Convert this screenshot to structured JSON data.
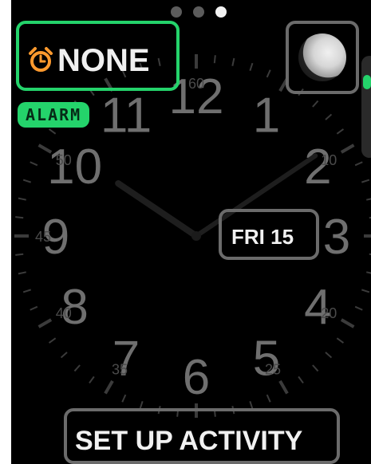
{
  "page_indicator": {
    "count": 3,
    "active_index": 2
  },
  "alarm": {
    "value": "NONE",
    "label": "ALARM"
  },
  "moon": {
    "phase": "waning-gibbous"
  },
  "date": {
    "text": "FRI 15"
  },
  "activity": {
    "label": "SET UP ACTIVITY"
  },
  "dial": {
    "hour_numerals": [
      "12",
      "1",
      "2",
      "3",
      "4",
      "5",
      "6",
      "7",
      "8",
      "9",
      "10",
      "11"
    ],
    "minute_markers": [
      "60",
      "10",
      "20",
      "25",
      "35",
      "40",
      "45",
      "50"
    ]
  },
  "colors": {
    "accent": "#24d36b",
    "frame": "#6b6b6b",
    "text": "#f1f1f1",
    "numeral": "#6f6f6f",
    "background": "#000000"
  },
  "icons": {
    "alarm": "alarm-clock-icon",
    "moon": "moon-phase-icon"
  }
}
